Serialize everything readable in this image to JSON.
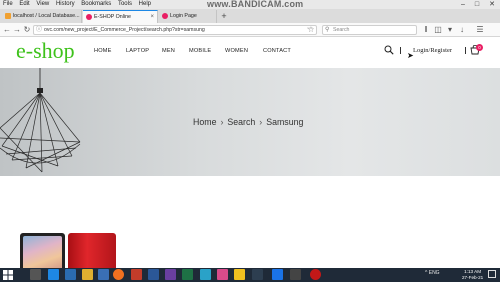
{
  "browser": {
    "menu": [
      "File",
      "Edit",
      "View",
      "History",
      "Bookmarks",
      "Tools",
      "Help"
    ],
    "watermark": "www.BANDICAM.com",
    "tabs": [
      {
        "label": "localhost / Local Database..."
      },
      {
        "label": "E-SHOP Online"
      },
      {
        "label": "Login Page"
      }
    ],
    "url": "ovc.com/new_project/E_Commerce_Project/search.php?str=samsung",
    "search_placeholder": "Search"
  },
  "site": {
    "logo": "e-shop",
    "nav": [
      "HOME",
      "LAPTOP",
      "MEN",
      "MOBILE",
      "WOMEN",
      "CONTACT"
    ],
    "login": "Login/Register",
    "cart_count": "0"
  },
  "hero": {
    "breadcrumb": [
      "Home",
      "Search",
      "Samsung"
    ]
  },
  "taskbar": {
    "tray": "^ ENG",
    "time": "1:13 AM",
    "date": "27-Feb-21"
  },
  "colors": {
    "logo": "#3ec21b",
    "badge": "#e91e63",
    "taskbar": "#1f2a38"
  }
}
